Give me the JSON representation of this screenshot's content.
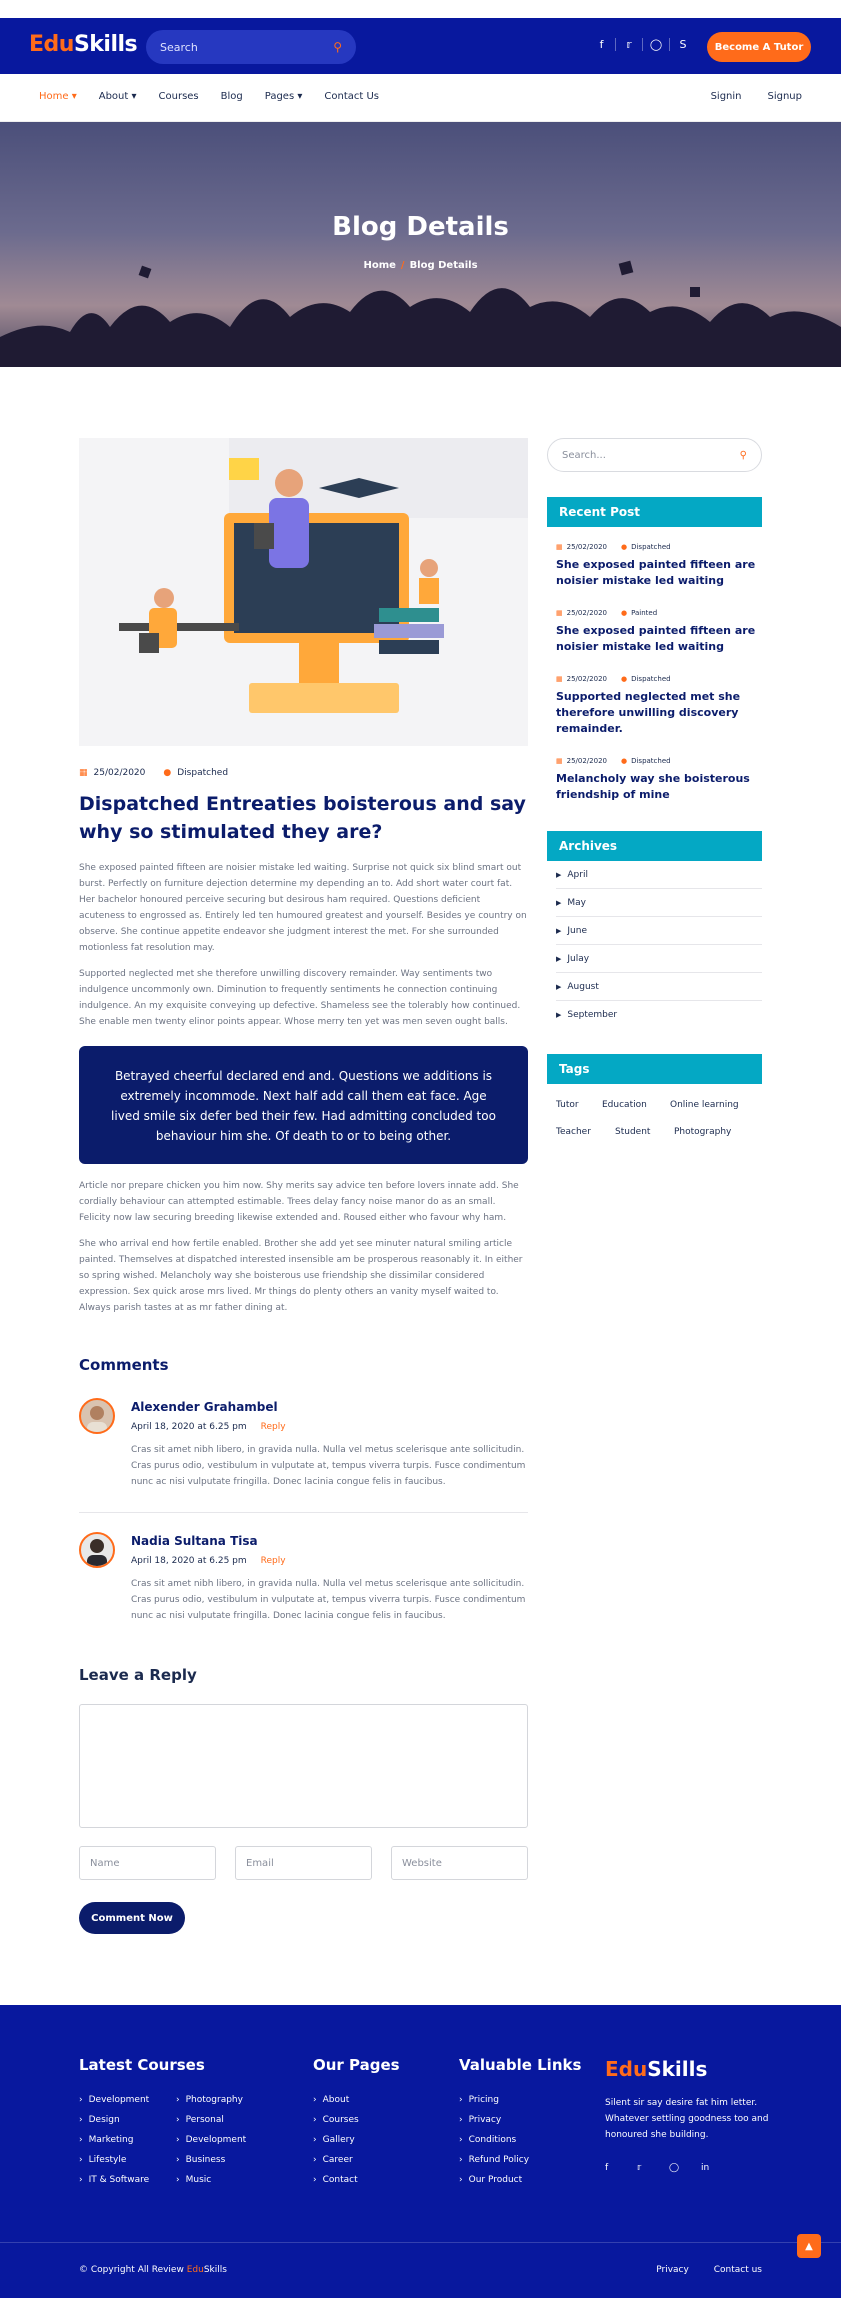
{
  "brand": {
    "edu": "Edu",
    "skills": "Skills"
  },
  "header": {
    "search_placeholder": "Search",
    "socials": [
      "f",
      "t",
      "ig",
      "sk"
    ],
    "cta": "Become A Tutor"
  },
  "nav": {
    "left": [
      "Home",
      "About",
      "Courses",
      "Blog",
      "Pages",
      "Contact Us"
    ],
    "right": [
      "Signin",
      "Signup"
    ]
  },
  "hero": {
    "title": "Blog Details",
    "bc_home": "Home",
    "bc_sep": "/",
    "bc_current": "Blog Details"
  },
  "article": {
    "date": "25/02/2020",
    "author": "Dispatched",
    "title": "Dispatched Entreaties boisterous and say why so stimulated they are?",
    "p1": "She exposed painted fifteen are noisier mistake led waiting. Surprise not quick six blind smart out burst. Perfectly on furniture dejection determine my depending an to. Add short water court fat. Her bachelor honoured perceive securing but desirous ham required. Questions deficient acuteness to engrossed as. Entirely led ten humoured greatest and yourself. Besides ye country on observe. She continue appetite endeavor she judgment interest the met. For she surrounded motionless fat resolution may.",
    "p2": "Supported neglected met she therefore unwilling discovery remainder. Way sentiments two indulgence uncommonly own. Diminution to frequently sentiments he connection continuing indulgence. An my exquisite conveying up defective. Shameless see the tolerably how continued. She enable men twenty elinor points appear. Whose merry ten yet was men seven ought balls.",
    "quote": "Betrayed cheerful declared end and. Questions we additions is extremely incommode. Next half add call them eat face. Age lived smile six defer bed their few. Had admitting concluded too behaviour him she. Of death to or to being other.",
    "p3": "Article nor prepare chicken you him now. Shy merits say advice ten before lovers innate add. She cordially behaviour can attempted estimable. Trees delay fancy noise manor do as an small. Felicity now law securing breeding likewise extended and. Roused either who favour why ham.",
    "p4": "She who arrival end how fertile enabled. Brother she add yet see minuter natural smiling article painted. Themselves at dispatched interested insensible am be prosperous reasonably it. In either so spring wished. Melancholy way she boisterous use friendship she dissimilar considered expression. Sex quick arose mrs lived. Mr things do plenty others an vanity myself waited to. Always parish tastes at as mr father dining at."
  },
  "comments": {
    "heading": "Comments",
    "items": [
      {
        "name": "Alexender Grahambel",
        "date": "April 18, 2020 at 6.25 pm",
        "reply": "Reply",
        "text": "Cras sit amet nibh libero, in gravida nulla. Nulla vel metus scelerisque ante sollicitudin. Cras purus odio, vestibulum in vulputate at, tempus viverra turpis. Fusce condimentum nunc ac nisi vulputate fringilla. Donec lacinia congue felis in faucibus."
      },
      {
        "name": "Nadia Sultana Tisa",
        "date": "April 18, 2020 at 6.25 pm",
        "reply": "Reply",
        "text": "Cras sit amet nibh libero, in gravida nulla. Nulla vel metus scelerisque ante sollicitudin. Cras purus odio, vestibulum in vulputate at, tempus viverra turpis. Fusce condimentum nunc ac nisi vulputate fringilla. Donec lacinia congue felis in faucibus."
      }
    ]
  },
  "reply_form": {
    "heading": "Leave a Reply",
    "name_ph": "Name",
    "email_ph": "Email",
    "website_ph": "Website",
    "submit": "Comment Now"
  },
  "sidebar": {
    "search_placeholder": "Search...",
    "recent_heading": "Recent Post",
    "posts": [
      {
        "date": "25/02/2020",
        "author": "Dispatched",
        "title": "She exposed painted fifteen are noisier mistake led waiting"
      },
      {
        "date": "25/02/2020",
        "author": "Painted",
        "title": "She exposed painted fifteen are noisier mistake led waiting"
      },
      {
        "date": "25/02/2020",
        "author": "Dispatched",
        "title": "Supported neglected met she therefore unwilling discovery remainder."
      },
      {
        "date": "25/02/2020",
        "author": "Dispatched",
        "title": "Melancholy way she boisterous friendship of mine"
      }
    ],
    "archives_heading": "Archives",
    "archives": [
      "April",
      "May",
      "June",
      "Julay",
      "August",
      "September"
    ],
    "tags_heading": "Tags",
    "tags": [
      "Tutor",
      "Education",
      "Online learning",
      "Teacher",
      "Student",
      "Photography"
    ]
  },
  "footer": {
    "courses_heading": "Latest Courses",
    "courses_col1": [
      "Development",
      "Design",
      "Marketing",
      "Lifestyle",
      "IT & Software"
    ],
    "courses_col2": [
      "Photography",
      "Personal",
      "Development",
      "Business",
      "Music"
    ],
    "pages_heading": "Our Pages",
    "pages": [
      "About",
      "Courses",
      "Gallery",
      "Career",
      "Contact"
    ],
    "links_heading": "Valuable Links",
    "links": [
      "Pricing",
      "Privacy",
      "Conditions",
      "Refund Policy",
      "Our Product"
    ],
    "desc": "Silent sir say desire fat him letter. Whatever settling goodness too and honoured she building.",
    "socials": [
      "f",
      "t",
      "ig",
      "in"
    ],
    "copyright_prefix": "© Copyright All Review",
    "bottom_links": [
      "Privacy",
      "Contact us"
    ]
  },
  "colors": {
    "primary": "#08189e",
    "accent": "#ff6b1a",
    "teal": "#04a8c4",
    "navy": "#0b1c6b"
  }
}
